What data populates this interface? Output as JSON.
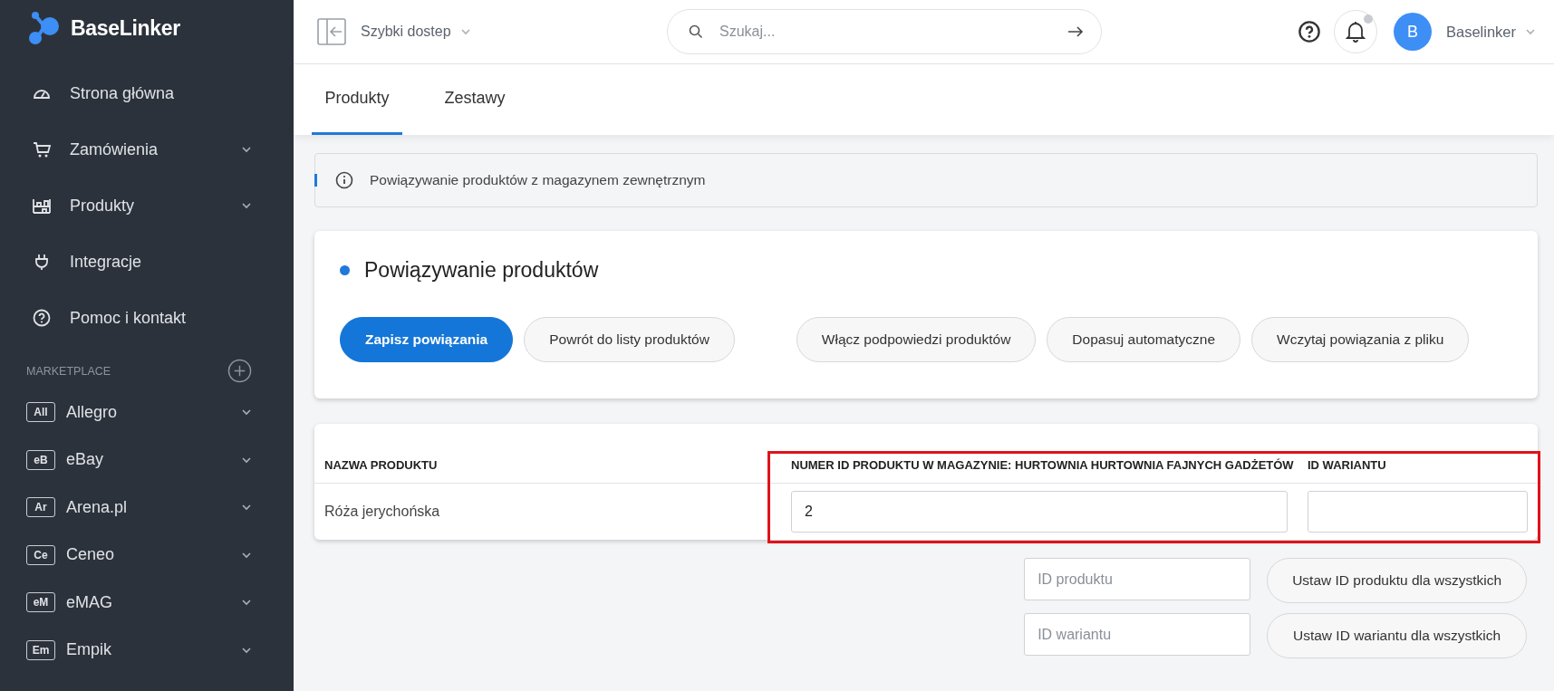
{
  "sidebar": {
    "logo": "BaseLinker",
    "items": [
      {
        "label": "Strona główna",
        "submenu": false
      },
      {
        "label": "Zamówienia",
        "submenu": true
      },
      {
        "label": "Produkty",
        "submenu": true
      },
      {
        "label": "Integracje",
        "submenu": false
      },
      {
        "label": "Pomoc i kontakt",
        "submenu": false
      }
    ],
    "section_title": "MARKETPLACE",
    "marketplaces": [
      {
        "badge": "All",
        "label": "Allegro",
        "submenu": true
      },
      {
        "badge": "eB",
        "label": "eBay",
        "submenu": true
      },
      {
        "badge": "Ar",
        "label": "Arena.pl",
        "submenu": true
      },
      {
        "badge": "Ce",
        "label": "Ceneo",
        "submenu": true
      },
      {
        "badge": "eM",
        "label": "eMAG",
        "submenu": true
      },
      {
        "badge": "Em",
        "label": "Empik",
        "submenu": true
      }
    ]
  },
  "topbar": {
    "quick_access": "Szybki dostep",
    "search": {
      "placeholder": "Szukaj..."
    },
    "notification_dot": true,
    "avatar": "B",
    "user": "Baselinker"
  },
  "tabs": [
    {
      "label": "Produkty",
      "selected": true
    },
    {
      "label": "Zestawy",
      "selected": false
    }
  ],
  "info": "Powiązywanie produktów z magazynem zewnętrznym",
  "card": {
    "title": "Powiązywanie produktów",
    "buttons": [
      {
        "label": "Zapisz powiązania",
        "primary": true
      },
      {
        "label": "Powrót do listy produktów",
        "primary": false
      },
      {
        "label": "Włącz podpowiedzi produktów",
        "primary": false
      },
      {
        "label": "Dopasuj automatyczne",
        "primary": false
      },
      {
        "label": "Wczytaj powiązania z pliku",
        "primary": false
      }
    ]
  },
  "table": {
    "columns": [
      "NAZWA PRODUKTU",
      "NUMER ID PRODUKTU W MAGAZYNIE: HURTOWNIA HURTOWNIA FAJNYCH GADŻETÓW",
      "ID WARIANTU"
    ],
    "rows": [
      {
        "name": "Róża jerychońska",
        "product_id": "2",
        "variant_id": ""
      }
    ]
  },
  "bulk": [
    {
      "placeholder": "ID produktu",
      "button": "Ustaw ID produktu dla wszystkich"
    },
    {
      "placeholder": "ID wariantu",
      "button": "Ustaw ID wariantu dla wszystkich"
    }
  ]
}
